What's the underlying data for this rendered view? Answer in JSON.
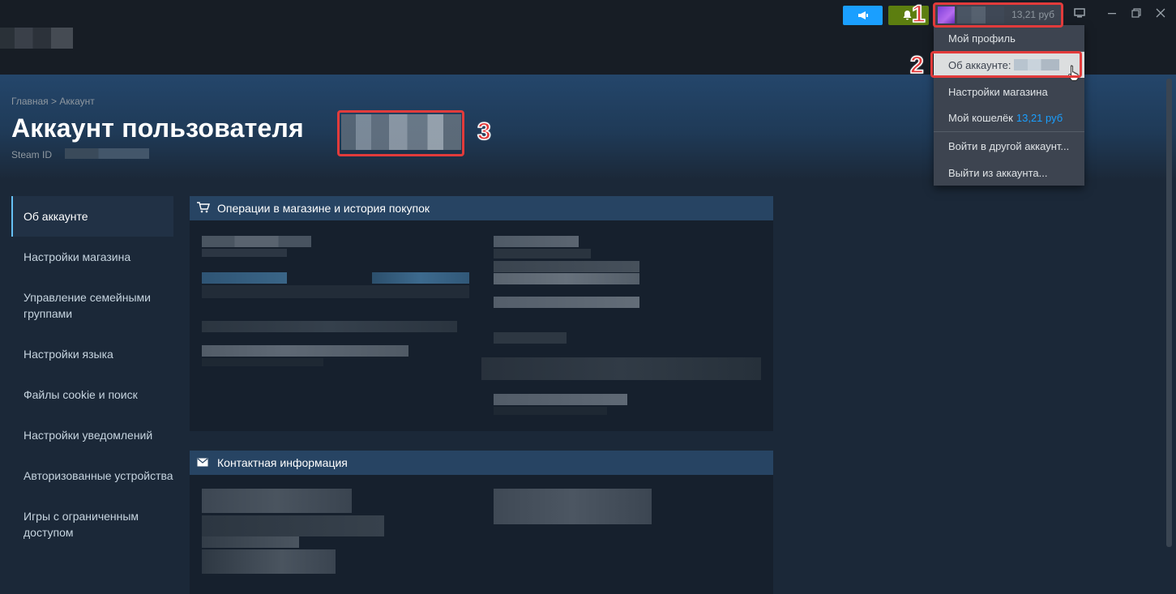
{
  "header": {
    "balance": "13,21 руб"
  },
  "dropdown": {
    "items": [
      {
        "label": "Мой профиль"
      },
      {
        "label": "Об аккаунте:"
      },
      {
        "label": "Настройки магазина"
      },
      {
        "label": "Мой кошелёк",
        "amount": "13,21 руб"
      },
      {
        "label": "Войти в другой аккаунт..."
      },
      {
        "label": "Выйти из аккаунта..."
      }
    ]
  },
  "page": {
    "breadcrumb": "Главная > Аккаунт",
    "title": "Аккаунт пользователя",
    "steamid_label": "Steam ID"
  },
  "nav": {
    "items": [
      {
        "label": "Об аккаунте",
        "active": true
      },
      {
        "label": "Настройки магазина"
      },
      {
        "label": "Управление семейными группами"
      },
      {
        "label": "Настройки языка"
      },
      {
        "label": "Файлы cookie и поиск"
      },
      {
        "label": "Настройки уведомлений"
      },
      {
        "label": "Авторизованные устройства"
      },
      {
        "label": "Игры с ограниченным доступом"
      }
    ]
  },
  "panels": {
    "store": {
      "title": "Операции в магазине и история покупок",
      "icon": "cart-icon"
    },
    "contact": {
      "title": "Контактная информация",
      "icon": "envelope-icon"
    }
  },
  "annotations": {
    "one": "1",
    "two": "2",
    "three": "3"
  },
  "colors": {
    "accent": "#1a9fff",
    "annotation": "#e23b3b",
    "notify": "#5c7e10"
  }
}
